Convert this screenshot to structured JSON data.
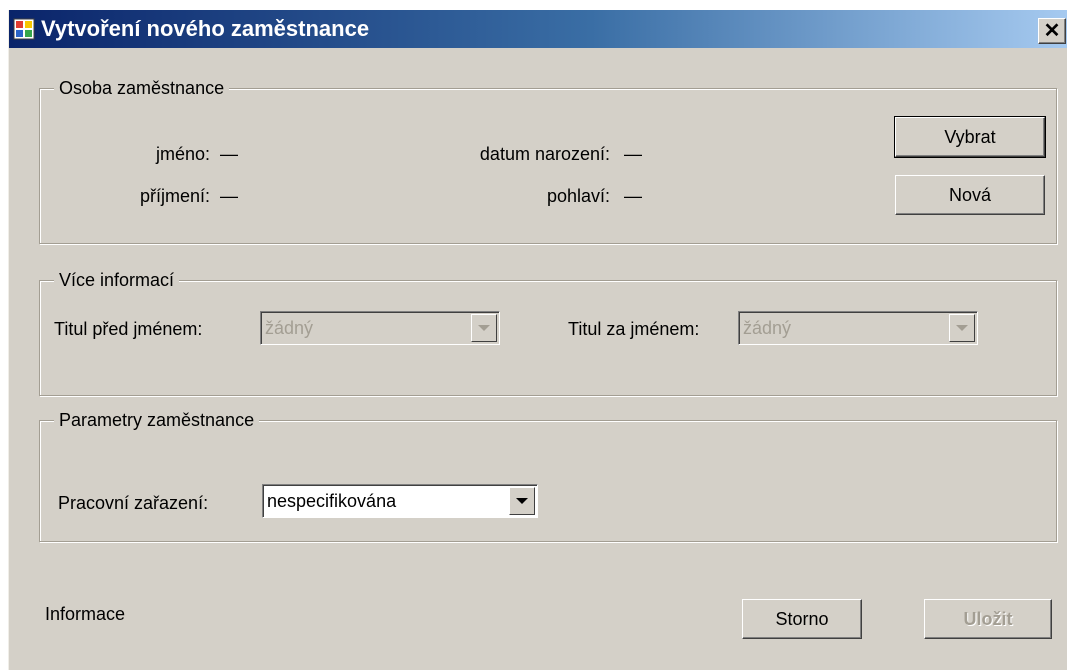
{
  "window": {
    "title": "Vytvoření nového zaměstnance",
    "close_glyph": "✕"
  },
  "person_group": {
    "legend": "Osoba zaměstnance",
    "first_name_label": "jméno:",
    "first_name_value": "—",
    "last_name_label": "příjmení:",
    "last_name_value": "—",
    "birth_date_label": "datum narození:",
    "birth_date_value": "—",
    "gender_label": "pohlaví:",
    "gender_value": "—",
    "select_button": "Vybrat",
    "new_button": "Nová"
  },
  "more_info_group": {
    "legend": "Více informací",
    "title_before_label": "Titul před jménem:",
    "title_before_value": "žádný",
    "title_after_label": "Titul za jménem:",
    "title_after_value": "žádný"
  },
  "params_group": {
    "legend": "Parametry zaměstnance",
    "position_label": "Pracovní zařazení:",
    "position_value": "nespecifikována"
  },
  "footer": {
    "info_text": "Informace",
    "cancel_button": "Storno",
    "save_button": "Uložit"
  },
  "colors": {
    "face": "#d4d0c8",
    "title_start": "#0a246a",
    "title_end": "#a6caf0",
    "disabled_text": "#a39e93"
  },
  "icons": {
    "app": "window-app-icon",
    "close": "close-icon",
    "dropdown": "chevron-down-icon"
  }
}
